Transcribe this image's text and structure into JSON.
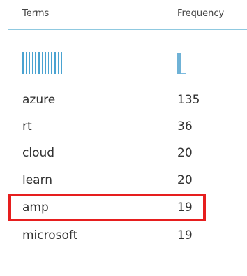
{
  "table": {
    "columns": {
      "terms": "Terms",
      "frequency": "Frequency"
    },
    "rows": [
      {
        "term": "azure",
        "frequency": "135"
      },
      {
        "term": "rt",
        "frequency": "36"
      },
      {
        "term": "cloud",
        "frequency": "20"
      },
      {
        "term": "learn",
        "frequency": "20"
      },
      {
        "term": "amp",
        "frequency": "19"
      },
      {
        "term": "microsoft",
        "frequency": "19"
      }
    ],
    "highlighted_row_index": 3
  },
  "colors": {
    "header_rule": "#8fc9e0",
    "term_sparkline": "#4aa3d1",
    "frequency_sparkline": "#6fb2d6",
    "highlight_border": "#e61e1e"
  },
  "icons": {
    "terms_sparkline": "term-distribution-bars-icon",
    "frequency_sparkline": "frequency-histogram-icon"
  }
}
